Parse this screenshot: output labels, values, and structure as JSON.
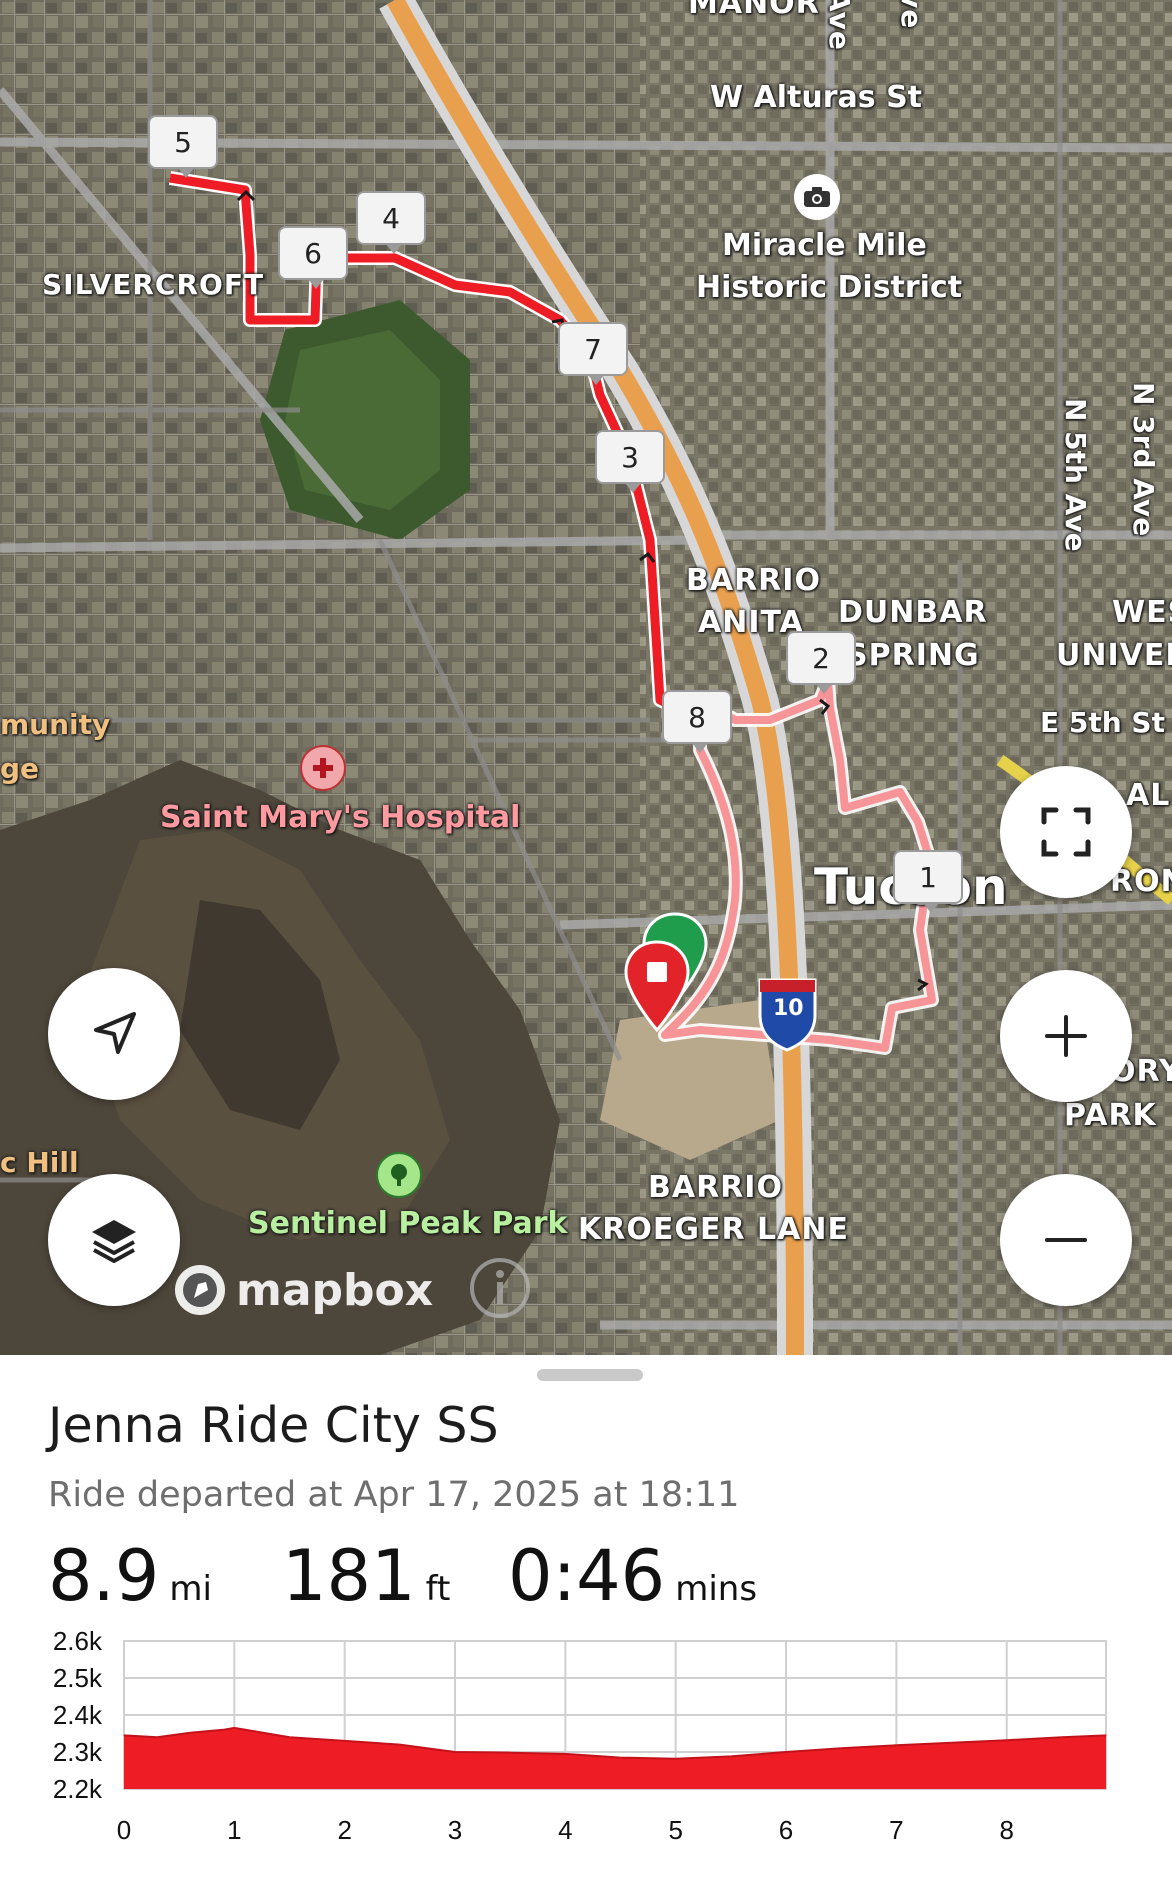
{
  "map": {
    "labels": {
      "manor": "MANOR",
      "ave1": "Ave",
      "ave2": "ve",
      "alturas": "W Alturas St",
      "miracle_mile": "Miracle Mile",
      "historic_district": "Historic District",
      "silvercroft": "SILVERCROFT",
      "n5th": "N 5th Ave",
      "n3rd": "N 3rd Ave",
      "barrio_anita_1": "BARRIO",
      "barrio_anita_2": "ANITA",
      "dunbar": "DUNBAR",
      "spring": "SPRING",
      "wes": "WES",
      "univer": "UNIVEF",
      "e5th": "E 5th St",
      "munity": "munity",
      "ge": "ge",
      "saint_marys": "Saint Mary's Hospital",
      "tucson": "Tucson",
      "al": "AL",
      "ron": "RON",
      "ory": "ORY",
      "park": "PARK",
      "c_hill": "c Hill",
      "sentinel": "Sentinel Peak Park",
      "barrio_kroeger_1": "BARRIO",
      "barrio_kroeger_2": "KROEGER LANE",
      "mapbox": "mapbox",
      "interstate": "10"
    },
    "waypoints": [
      "5",
      "4",
      "6",
      "7",
      "3",
      "2",
      "8",
      "1"
    ],
    "icons": [
      "camera-icon",
      "hospital-icon",
      "park-tree-icon",
      "mapbox-logo-icon",
      "info-icon",
      "start-pin-icon",
      "end-pin-icon",
      "interstate-shield-icon"
    ],
    "controls": {
      "recenter": "location-arrow-icon",
      "layers": "layers-icon",
      "fullscreen": "fullscreen-icon",
      "zoom_in": "plus-icon",
      "zoom_out": "minus-icon"
    },
    "colors": {
      "route": "#ee1c25",
      "route_light": "#f79498",
      "highway": "#e9a04e",
      "start_pin": "#1f9d4c",
      "end_pin": "#e2232a"
    }
  },
  "ride": {
    "title": "Jenna Ride City SS",
    "subtitle": "Ride departed at Apr 17, 2025 at 18:11",
    "distance_value": "8.9",
    "distance_unit": "mi",
    "elevation_value": "181",
    "elevation_unit": "ft",
    "duration_value": "0:46",
    "duration_unit": "mins"
  },
  "chart_data": {
    "type": "area",
    "ylabel": "",
    "xlabel": "",
    "y_tick_labels": [
      "2.6k",
      "2.5k",
      "2.4k",
      "2.3k",
      "2.2k"
    ],
    "x_tick_labels": [
      "0",
      "1",
      "2",
      "3",
      "4",
      "5",
      "6",
      "7",
      "8"
    ],
    "ylim": [
      2200,
      2600
    ],
    "xlim": [
      0,
      8.9
    ],
    "grid": true,
    "color": "#ee1c25",
    "x": [
      0,
      0.3,
      0.6,
      0.9,
      1.0,
      1.2,
      1.5,
      2.0,
      2.5,
      3.0,
      3.5,
      4.0,
      4.5,
      5.0,
      5.5,
      6.0,
      6.5,
      7.0,
      7.5,
      8.0,
      8.5,
      8.9
    ],
    "y": [
      2345,
      2340,
      2352,
      2360,
      2365,
      2355,
      2340,
      2330,
      2320,
      2300,
      2298,
      2295,
      2285,
      2282,
      2288,
      2300,
      2310,
      2318,
      2325,
      2332,
      2340,
      2345
    ]
  }
}
